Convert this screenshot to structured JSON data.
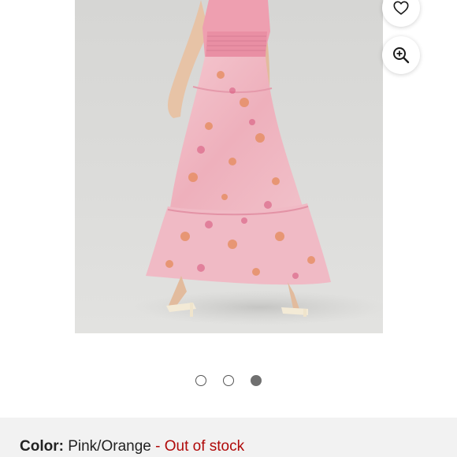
{
  "product": {
    "image_alt": "Model wearing pink floral tiered maxi dress, back view",
    "carousel": {
      "total": 3,
      "active_index": 2
    }
  },
  "actions": {
    "wishlist_icon": "heart-icon",
    "zoom_icon": "zoom-in-icon"
  },
  "info": {
    "color_label": "Color:",
    "color_value": "Pink/Orange",
    "separator": " - ",
    "stock_status": "Out of stock"
  },
  "colors": {
    "stock_status": "#b00a0a",
    "info_bg": "#f2f2f2",
    "dress_pink": "#f0b6c2",
    "dress_orange": "#e58a5a"
  }
}
